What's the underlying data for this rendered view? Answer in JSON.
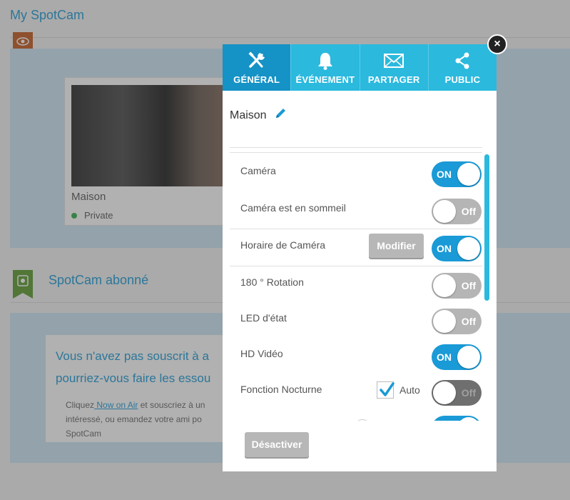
{
  "app": {
    "title": "My SpotCam"
  },
  "camera_card": {
    "name": "Maison",
    "status": "Private"
  },
  "subscription": {
    "section_title": "SpotCam abonné"
  },
  "promo": {
    "heading_line1": "Vous n'avez pas souscrit à a",
    "heading_line2": "pourriez-vous faire les essou",
    "text_prefix": "Cliquez",
    "link": " Now on Air",
    "text_line1_suffix": " et souscriez à un",
    "text_line2": "intéressé, ou emandez votre ami po",
    "text_line3": "SpotCam"
  },
  "modal": {
    "close_label": "×",
    "tabs": [
      {
        "label": "GÉNÉRAL",
        "icon": "tools-icon",
        "active": true
      },
      {
        "label": "ÉVÉNEMENT",
        "icon": "bell-icon",
        "active": false
      },
      {
        "label": "PARTAGER",
        "icon": "envelope-icon",
        "active": false
      },
      {
        "label": "PUBLIC",
        "icon": "share-icon",
        "active": false
      }
    ],
    "camera_name": "Maison",
    "settings": [
      {
        "label": "Caméra",
        "state": "ON"
      },
      {
        "label": "Caméra est en sommeil",
        "state": "Off"
      },
      {
        "label": "Horaire de Caméra",
        "state": "ON",
        "button": "Modifier"
      },
      {
        "label": "180 ° Rotation",
        "state": "Off"
      },
      {
        "label": "LED d'état",
        "state": "Off"
      },
      {
        "label": "HD Vidéo",
        "state": "ON"
      },
      {
        "label": "Fonction Nocturne",
        "state": "Off",
        "checkbox": "Auto",
        "checkbox_checked": true
      }
    ],
    "deactivate_label": "Désactiver"
  },
  "colors": {
    "accent": "#1a9ad6",
    "tab": "#2bb9de",
    "tab_active": "#1592c6",
    "toggle_off": "#b5b5b5"
  }
}
